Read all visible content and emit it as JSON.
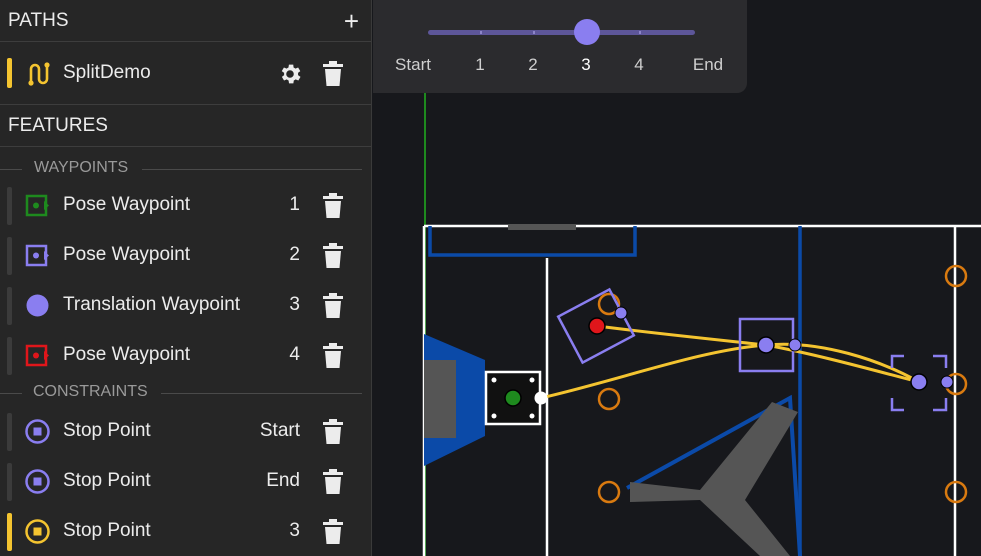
{
  "paths": {
    "header": "PATHS",
    "add_label": "+",
    "items": [
      {
        "label": "SplitDemo"
      }
    ]
  },
  "features": {
    "header": "FEATURES",
    "waypoints_label": "WAYPOINTS",
    "constraints_label": "CONSTRAINTS",
    "waypoints": [
      {
        "label": "Pose Waypoint",
        "value": "1",
        "icon": "pose-waypoint-icon",
        "color": "#1e8a1e"
      },
      {
        "label": "Pose Waypoint",
        "value": "2",
        "icon": "pose-waypoint-icon",
        "color": "#8a7ef0"
      },
      {
        "label": "Translation Waypoint",
        "value": "3",
        "icon": "translation-waypoint-icon",
        "color": "#8a7ef0"
      },
      {
        "label": "Pose Waypoint",
        "value": "4",
        "icon": "pose-waypoint-icon",
        "color": "#e0161b"
      }
    ],
    "constraints": [
      {
        "label": "Stop Point",
        "value": "Start",
        "color": "#8a7ef0",
        "selected": false
      },
      {
        "label": "Stop Point",
        "value": "End",
        "color": "#8a7ef0",
        "selected": false
      },
      {
        "label": "Stop Point",
        "value": "3",
        "color": "#f4c430",
        "selected": true
      }
    ]
  },
  "timeline": {
    "labels": [
      "Start",
      "1",
      "2",
      "3",
      "4",
      "End"
    ],
    "selected_index": 3
  },
  "colors": {
    "accent": "#f4c430",
    "waypoint_purple": "#8a7ef0",
    "path_yellow": "#f4c430",
    "field_blue": "#0b4aa8",
    "field_orange": "#d97a10"
  }
}
